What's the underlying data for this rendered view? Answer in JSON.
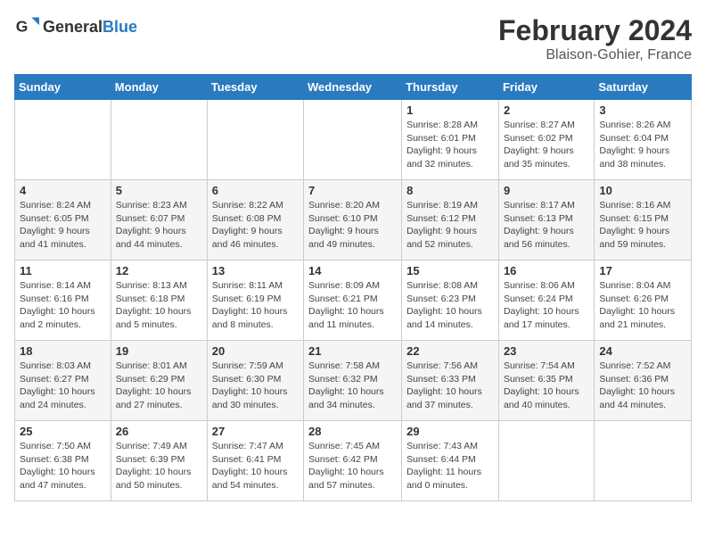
{
  "header": {
    "logo_general": "General",
    "logo_blue": "Blue",
    "title": "February 2024",
    "location": "Blaison-Gohier, France"
  },
  "columns": [
    "Sunday",
    "Monday",
    "Tuesday",
    "Wednesday",
    "Thursday",
    "Friday",
    "Saturday"
  ],
  "weeks": [
    [
      {
        "day": "",
        "info": ""
      },
      {
        "day": "",
        "info": ""
      },
      {
        "day": "",
        "info": ""
      },
      {
        "day": "",
        "info": ""
      },
      {
        "day": "1",
        "info": "Sunrise: 8:28 AM\nSunset: 6:01 PM\nDaylight: 9 hours and 32 minutes."
      },
      {
        "day": "2",
        "info": "Sunrise: 8:27 AM\nSunset: 6:02 PM\nDaylight: 9 hours and 35 minutes."
      },
      {
        "day": "3",
        "info": "Sunrise: 8:26 AM\nSunset: 6:04 PM\nDaylight: 9 hours and 38 minutes."
      }
    ],
    [
      {
        "day": "4",
        "info": "Sunrise: 8:24 AM\nSunset: 6:05 PM\nDaylight: 9 hours and 41 minutes."
      },
      {
        "day": "5",
        "info": "Sunrise: 8:23 AM\nSunset: 6:07 PM\nDaylight: 9 hours and 44 minutes."
      },
      {
        "day": "6",
        "info": "Sunrise: 8:22 AM\nSunset: 6:08 PM\nDaylight: 9 hours and 46 minutes."
      },
      {
        "day": "7",
        "info": "Sunrise: 8:20 AM\nSunset: 6:10 PM\nDaylight: 9 hours and 49 minutes."
      },
      {
        "day": "8",
        "info": "Sunrise: 8:19 AM\nSunset: 6:12 PM\nDaylight: 9 hours and 52 minutes."
      },
      {
        "day": "9",
        "info": "Sunrise: 8:17 AM\nSunset: 6:13 PM\nDaylight: 9 hours and 56 minutes."
      },
      {
        "day": "10",
        "info": "Sunrise: 8:16 AM\nSunset: 6:15 PM\nDaylight: 9 hours and 59 minutes."
      }
    ],
    [
      {
        "day": "11",
        "info": "Sunrise: 8:14 AM\nSunset: 6:16 PM\nDaylight: 10 hours and 2 minutes."
      },
      {
        "day": "12",
        "info": "Sunrise: 8:13 AM\nSunset: 6:18 PM\nDaylight: 10 hours and 5 minutes."
      },
      {
        "day": "13",
        "info": "Sunrise: 8:11 AM\nSunset: 6:19 PM\nDaylight: 10 hours and 8 minutes."
      },
      {
        "day": "14",
        "info": "Sunrise: 8:09 AM\nSunset: 6:21 PM\nDaylight: 10 hours and 11 minutes."
      },
      {
        "day": "15",
        "info": "Sunrise: 8:08 AM\nSunset: 6:23 PM\nDaylight: 10 hours and 14 minutes."
      },
      {
        "day": "16",
        "info": "Sunrise: 8:06 AM\nSunset: 6:24 PM\nDaylight: 10 hours and 17 minutes."
      },
      {
        "day": "17",
        "info": "Sunrise: 8:04 AM\nSunset: 6:26 PM\nDaylight: 10 hours and 21 minutes."
      }
    ],
    [
      {
        "day": "18",
        "info": "Sunrise: 8:03 AM\nSunset: 6:27 PM\nDaylight: 10 hours and 24 minutes."
      },
      {
        "day": "19",
        "info": "Sunrise: 8:01 AM\nSunset: 6:29 PM\nDaylight: 10 hours and 27 minutes."
      },
      {
        "day": "20",
        "info": "Sunrise: 7:59 AM\nSunset: 6:30 PM\nDaylight: 10 hours and 30 minutes."
      },
      {
        "day": "21",
        "info": "Sunrise: 7:58 AM\nSunset: 6:32 PM\nDaylight: 10 hours and 34 minutes."
      },
      {
        "day": "22",
        "info": "Sunrise: 7:56 AM\nSunset: 6:33 PM\nDaylight: 10 hours and 37 minutes."
      },
      {
        "day": "23",
        "info": "Sunrise: 7:54 AM\nSunset: 6:35 PM\nDaylight: 10 hours and 40 minutes."
      },
      {
        "day": "24",
        "info": "Sunrise: 7:52 AM\nSunset: 6:36 PM\nDaylight: 10 hours and 44 minutes."
      }
    ],
    [
      {
        "day": "25",
        "info": "Sunrise: 7:50 AM\nSunset: 6:38 PM\nDaylight: 10 hours and 47 minutes."
      },
      {
        "day": "26",
        "info": "Sunrise: 7:49 AM\nSunset: 6:39 PM\nDaylight: 10 hours and 50 minutes."
      },
      {
        "day": "27",
        "info": "Sunrise: 7:47 AM\nSunset: 6:41 PM\nDaylight: 10 hours and 54 minutes."
      },
      {
        "day": "28",
        "info": "Sunrise: 7:45 AM\nSunset: 6:42 PM\nDaylight: 10 hours and 57 minutes."
      },
      {
        "day": "29",
        "info": "Sunrise: 7:43 AM\nSunset: 6:44 PM\nDaylight: 11 hours and 0 minutes."
      },
      {
        "day": "",
        "info": ""
      },
      {
        "day": "",
        "info": ""
      }
    ]
  ]
}
